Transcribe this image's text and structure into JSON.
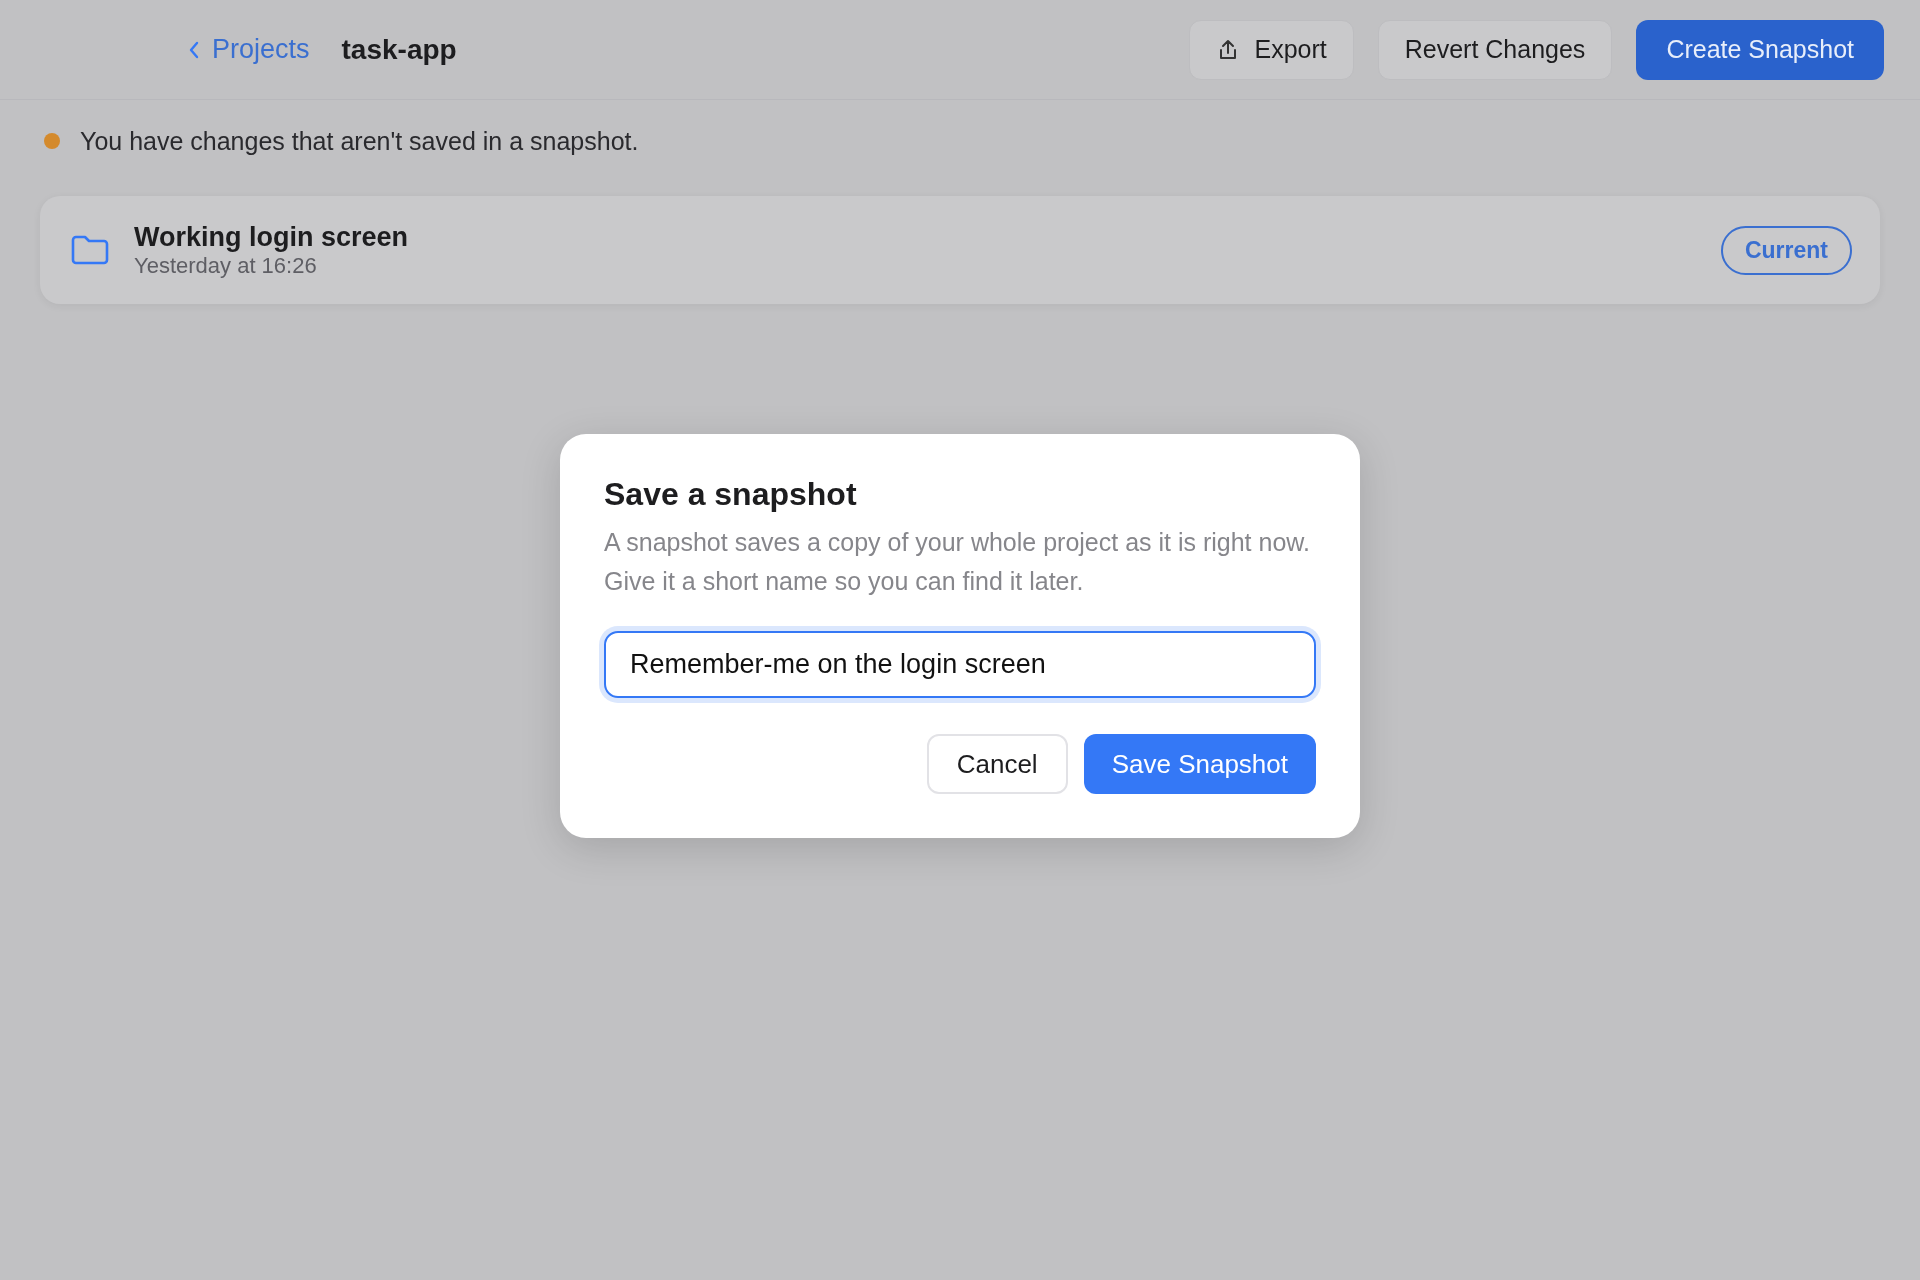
{
  "header": {
    "back_link": "Projects",
    "project_name": "task-app",
    "buttons": [
      {
        "kind": "export",
        "label": "Export"
      },
      {
        "kind": "secondary",
        "label": "Revert Changes"
      },
      {
        "kind": "primary",
        "label": "Create Snapshot"
      }
    ]
  },
  "notice": {
    "text": "You have changes that aren't saved in a snapshot.",
    "color": "#d48a2c"
  },
  "snapshots": [
    {
      "name": "Working login screen",
      "time": "Yesterday at 16:26",
      "badge": "Current"
    }
  ],
  "dialog": {
    "title": "Save a snapshot",
    "description": "A snapshot saves a copy of your whole project as it is right now. Give it a short name so you can find it later.",
    "name_field": {
      "value": "Remember-me on the login screen"
    },
    "buttons": [
      {
        "kind": "secondary",
        "label": "Cancel"
      },
      {
        "kind": "primary",
        "label": "Save Snapshot"
      }
    ]
  }
}
